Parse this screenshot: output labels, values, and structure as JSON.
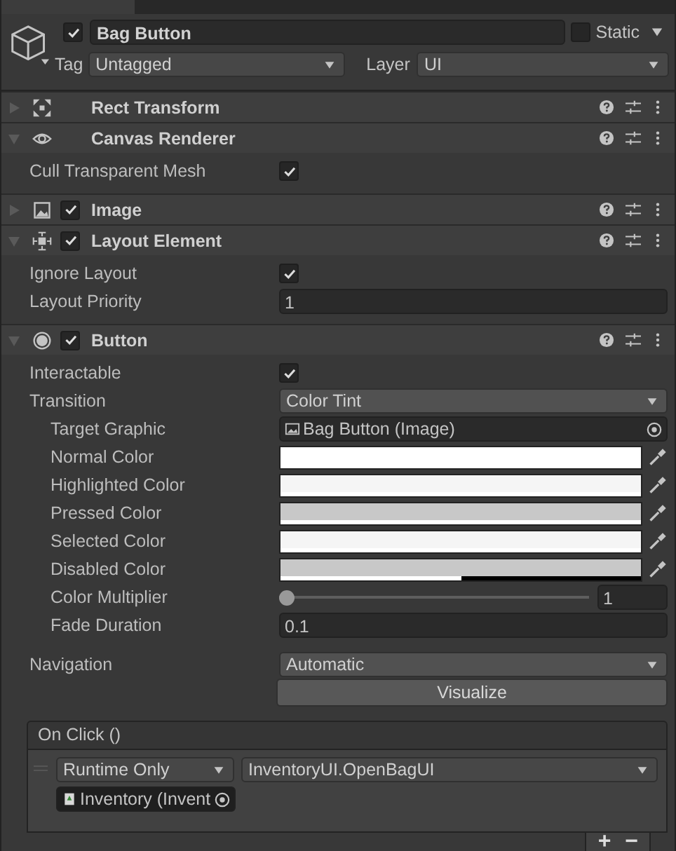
{
  "object": {
    "active": true,
    "name": "Bag Button",
    "static": false,
    "static_label": "Static",
    "tag_label": "Tag",
    "tag": "Untagged",
    "layer_label": "Layer",
    "layer": "UI"
  },
  "components": [
    {
      "name": "Rect Transform",
      "expanded": false
    },
    {
      "name": "Canvas Renderer",
      "expanded": true,
      "properties": [
        {
          "kind": "checkbox",
          "label": "Cull Transparent Mesh",
          "checked": true
        }
      ]
    },
    {
      "name": "Image",
      "enabled": true,
      "expanded": false
    },
    {
      "name": "Layout Element",
      "enabled": true,
      "expanded": true,
      "properties": [
        {
          "kind": "checkbox",
          "label": "Ignore Layout",
          "checked": true
        },
        {
          "kind": "field",
          "label": "Layout Priority",
          "value": "1"
        }
      ]
    },
    {
      "name": "Button",
      "enabled": true,
      "expanded": true,
      "properties": [
        {
          "kind": "checkbox",
          "label": "Interactable",
          "checked": true
        },
        {
          "kind": "dropdown",
          "label": "Transition",
          "value": "Color Tint",
          "children": [
            {
              "kind": "object",
              "label": "Target Graphic",
              "value": "Bag Button (Image)"
            },
            {
              "kind": "color",
              "label": "Normal Color",
              "color": "#ffffff",
              "level": 1
            },
            {
              "kind": "color",
              "label": "Highlighted Color",
              "color": "#f5f5f5",
              "level": 1
            },
            {
              "kind": "color",
              "label": "Pressed Color",
              "color": "#c8c8c8",
              "level": 1
            },
            {
              "kind": "color",
              "label": "Selected Color",
              "color": "#f5f5f5",
              "level": 1
            },
            {
              "kind": "color",
              "label": "Disabled Color",
              "color": "#c8c8c8",
              "level": 0.5
            },
            {
              "kind": "slider",
              "label": "Color Multiplier",
              "level": 0,
              "value": "1"
            },
            {
              "kind": "field",
              "label": "Fade Duration",
              "value": "0.1"
            }
          ]
        },
        {
          "kind": "gap"
        },
        {
          "kind": "dropdown",
          "label": "Navigation",
          "value": "Automatic"
        },
        {
          "kind": "button",
          "value": "Visualize"
        }
      ],
      "event": {
        "title": "On Click ()",
        "entries": [
          {
            "call_state": "Runtime Only",
            "function": "InventoryUI.OpenBagUI",
            "target": "Inventory (Invent"
          }
        ],
        "add": "+",
        "remove": "−"
      }
    }
  ]
}
